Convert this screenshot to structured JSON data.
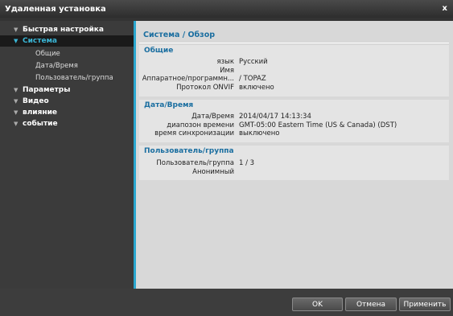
{
  "window": {
    "title": "Удаленная установка",
    "close_label": "x"
  },
  "sidebar": {
    "items": [
      {
        "label": "Быстрая настройка",
        "arrow": "▼"
      },
      {
        "label": "Система",
        "arrow": "▼",
        "active": true,
        "children": [
          "Общие",
          "Дата/Время",
          "Пользователь/группа"
        ]
      },
      {
        "label": "Параметры",
        "arrow": "▼"
      },
      {
        "label": "Видео",
        "arrow": "▼"
      },
      {
        "label": "влияние",
        "arrow": "▼"
      },
      {
        "label": "событие",
        "arrow": "▼"
      }
    ]
  },
  "main": {
    "title": "Система / Обзор",
    "sections": [
      {
        "title": "Общие",
        "rows": [
          {
            "label": "язык",
            "value": "Русский"
          },
          {
            "label": "Имя",
            "value": ""
          },
          {
            "label": "Аппаратное/программн...",
            "value": "/ TOPAZ"
          },
          {
            "label": "Протокол ONVIF",
            "value": "включено"
          }
        ]
      },
      {
        "title": "Дата/Время",
        "rows": [
          {
            "label": "Дата/Время",
            "value": "2014/04/17 14:13:34"
          },
          {
            "label": "диапозон времени",
            "value": "GMT-05:00 Eastern Time (US & Canada) (DST)"
          },
          {
            "label": "время синхронизации",
            "value": "выключено"
          }
        ]
      },
      {
        "title": "Пользователь/группа",
        "rows": [
          {
            "label": "Пользователь/группа",
            "value": "1 / 3"
          },
          {
            "label": "Анонимный",
            "value": ""
          }
        ]
      }
    ]
  },
  "footer": {
    "ok_label": "OK",
    "cancel_label": "Отмена",
    "apply_label": "Применить"
  }
}
